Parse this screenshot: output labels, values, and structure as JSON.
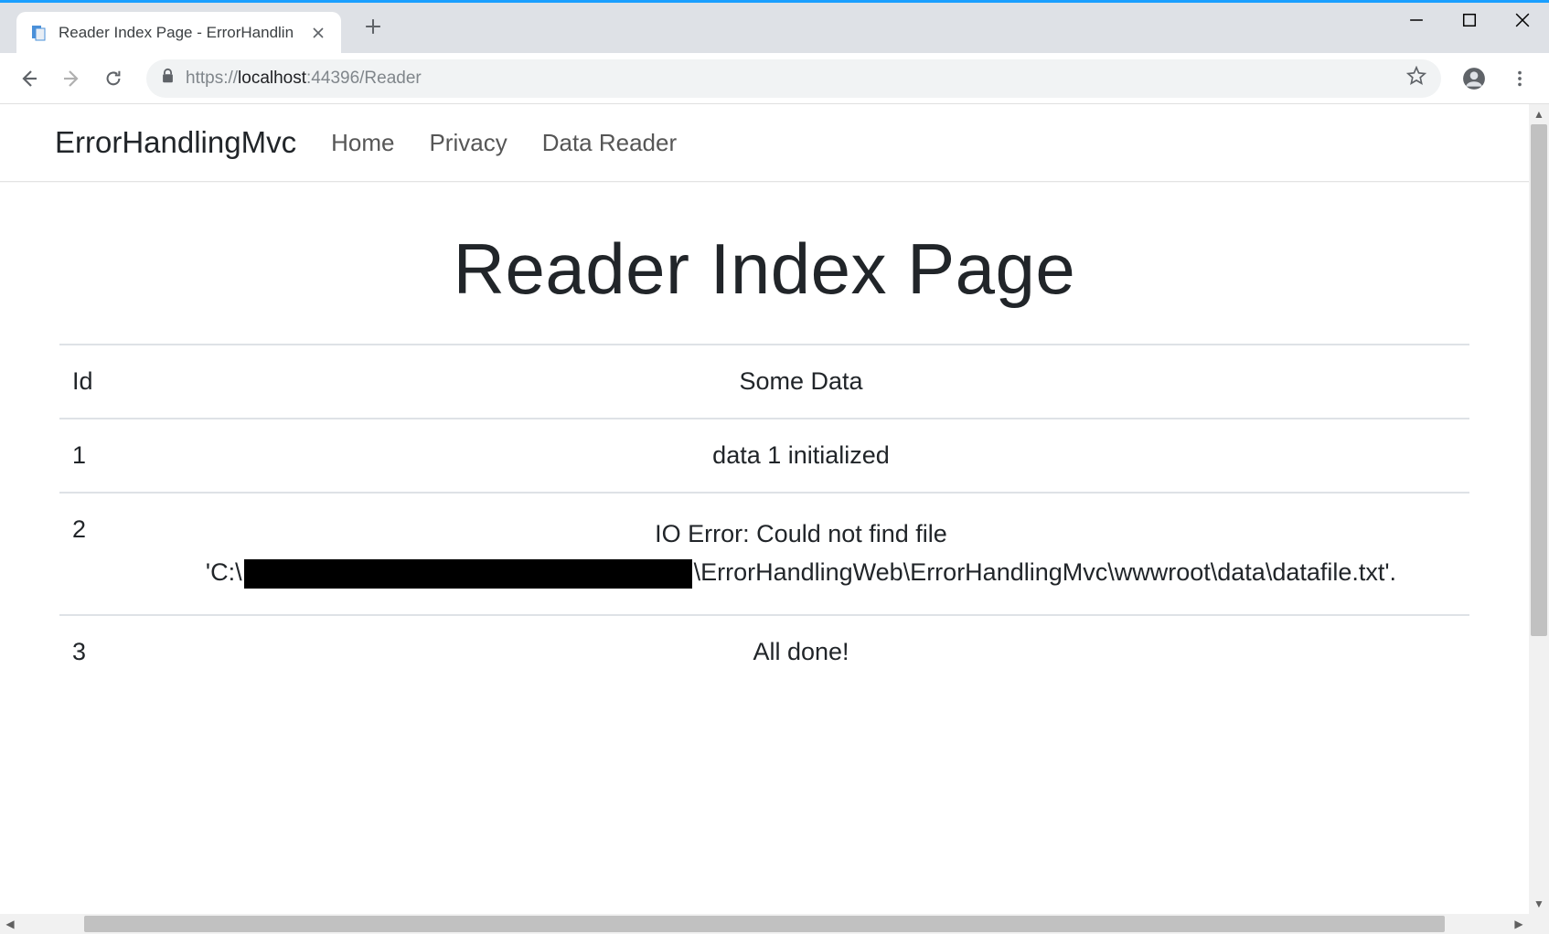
{
  "browser": {
    "tab_title": "Reader Index Page - ErrorHandlin",
    "url_scheme": "https://",
    "url_host": "localhost",
    "url_port": ":44396",
    "url_path": "/Reader"
  },
  "nav": {
    "brand": "ErrorHandlingMvc",
    "links": [
      "Home",
      "Privacy",
      "Data Reader"
    ]
  },
  "page": {
    "title": "Reader Index Page",
    "columns": {
      "id": "Id",
      "data": "Some Data"
    },
    "rows": [
      {
        "id": "1",
        "data": "data 1 initialized"
      },
      {
        "id": "2",
        "data_line1": "IO Error: Could not find file",
        "data_prefix": "'C:\\",
        "data_suffix": "\\ErrorHandlingWeb\\ErrorHandlingMvc\\wwwroot\\data\\datafile.txt'."
      },
      {
        "id": "3",
        "data": "All done!"
      }
    ]
  }
}
